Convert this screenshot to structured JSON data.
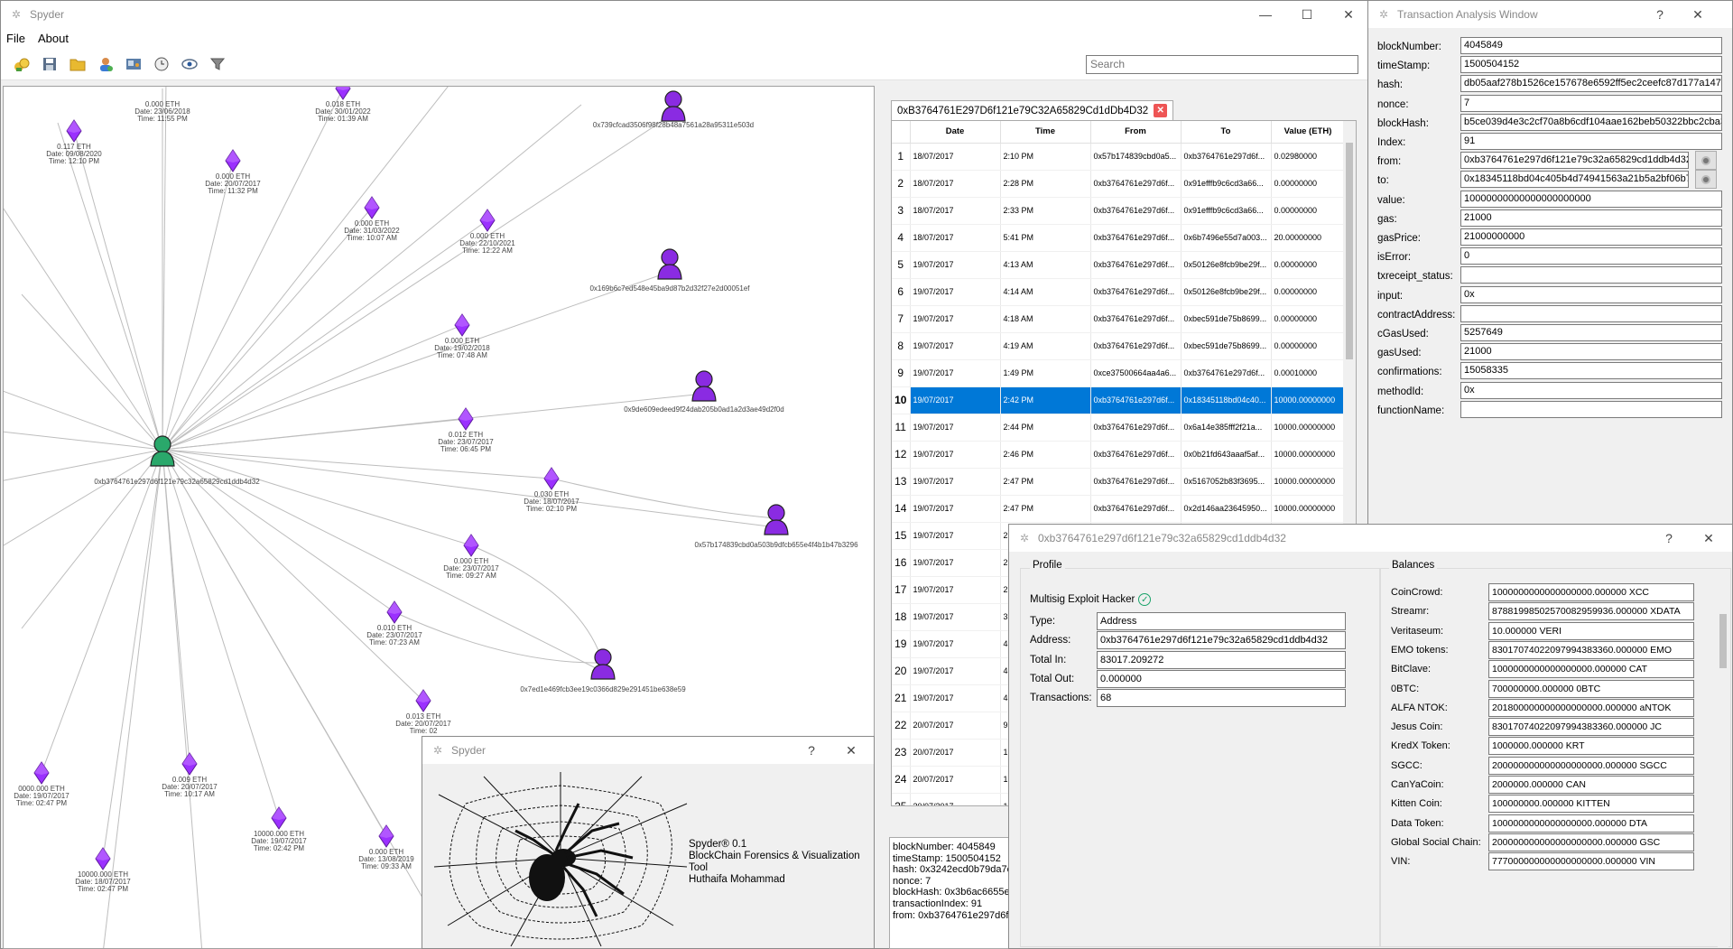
{
  "main_window": {
    "title": "Spyder",
    "menu": [
      "File",
      "About"
    ],
    "search_placeholder": "Search",
    "toolbar_icons": [
      "open-wallet-icon",
      "save-icon",
      "folder-icon",
      "user-icon",
      "card-icon",
      "clock-icon",
      "eye-icon",
      "filter-icon"
    ]
  },
  "graph": {
    "center_node": "0xb3764761e297d6f121e79c32a65829cd1ddb4d32",
    "accounts": [
      "0x739cfcad3506f98f28b48a7561a28a95311e503d",
      "0x169b6c7ed548e45ba9d87b2d32f27e2d00051ef",
      "0x9de609edeed9f24dab205b0ad1a2d3ae49d2f0d",
      "0x57b174839cbd0a503b9dfcb655e4f4b1b47b3296",
      "0x7ed1e469fcb3ee19c0366d829e291451be638e59"
    ],
    "transactions": [
      {
        "amount": "0.117 ETH",
        "date": "Date: 09/08/2020",
        "time": "Time: 12:10 PM"
      },
      {
        "amount": "0.000 ETH",
        "date": "Date: 23/06/2018",
        "time": "Time: 11:55 PM"
      },
      {
        "amount": "0.000 ETH",
        "date": "Date: 20/07/2017",
        "time": "Time: 11:32 PM"
      },
      {
        "amount": "0.018 ETH",
        "date": "Date: 30/01/2022",
        "time": "Time: 01:39 AM"
      },
      {
        "amount": "0.000 ETH",
        "date": "Date: 31/03/2022",
        "time": "Time: 10:07 AM"
      },
      {
        "amount": "0.000 ETH",
        "date": "Date: 22/10/2021",
        "time": "Time: 12:22 AM"
      },
      {
        "amount": "0.000 ETH",
        "date": "Date: 19/02/2018",
        "time": "Time: 07:48 AM"
      },
      {
        "amount": "0.012 ETH",
        "date": "Date: 23/07/2017",
        "time": "Time: 06:45 PM"
      },
      {
        "amount": "0.030 ETH",
        "date": "Date: 18/07/2017",
        "time": "Time: 02:10 PM"
      },
      {
        "amount": "0.000 ETH",
        "date": "Date: 23/07/2017",
        "time": "Time: 09:27 AM"
      },
      {
        "amount": "0.010 ETH",
        "date": "Date: 23/07/2017",
        "time": "Time: 07:23 AM"
      },
      {
        "amount": "0.013 ETH",
        "date": "Date: 20/07/2017",
        "time": "Time: 02"
      },
      {
        "amount": "0000.000 ETH",
        "date": "Date: 19/07/2017",
        "time": "Time: 02:47 PM"
      },
      {
        "amount": "0.009 ETH",
        "date": "Date: 20/07/2017",
        "time": "Time: 10:17 AM"
      },
      {
        "amount": "10000.000 ETH",
        "date": "Date: 19/07/2017",
        "time": "Time: 02:42 PM"
      },
      {
        "amount": "0.000 ETH",
        "date": "Date: 13/08/2019",
        "time": "Time: 09:33 AM"
      },
      {
        "amount": "10000.000 ETH",
        "date": "Date: 18/07/2017",
        "time": "Time: 02:47 PM"
      }
    ]
  },
  "tab": {
    "label": "0xB3764761E297D6f121e79C32A65829Cd1dDb4D32"
  },
  "table": {
    "headers": [
      "Date",
      "Time",
      "From",
      "To",
      "Value (ETH)"
    ],
    "selected_index": 9,
    "rows": [
      {
        "n": "1",
        "date": "18/07/2017",
        "time": "2:10 PM",
        "from": "0x57b174839cbd0a5...",
        "to": "0xb3764761e297d6f...",
        "value": "0.02980000"
      },
      {
        "n": "2",
        "date": "18/07/2017",
        "time": "2:28 PM",
        "from": "0xb3764761e297d6f...",
        "to": "0x91efffb9c6cd3a66...",
        "value": "0.00000000"
      },
      {
        "n": "3",
        "date": "18/07/2017",
        "time": "2:33 PM",
        "from": "0xb3764761e297d6f...",
        "to": "0x91efffb9c6cd3a66...",
        "value": "0.00000000"
      },
      {
        "n": "4",
        "date": "18/07/2017",
        "time": "5:41 PM",
        "from": "0xb3764761e297d6f...",
        "to": "0x6b7496e55d7a003...",
        "value": "20.00000000"
      },
      {
        "n": "5",
        "date": "19/07/2017",
        "time": "4:13 AM",
        "from": "0xb3764761e297d6f...",
        "to": "0x50126e8fcb9be29f...",
        "value": "0.00000000"
      },
      {
        "n": "6",
        "date": "19/07/2017",
        "time": "4:14 AM",
        "from": "0xb3764761e297d6f...",
        "to": "0x50126e8fcb9be29f...",
        "value": "0.00000000"
      },
      {
        "n": "7",
        "date": "19/07/2017",
        "time": "4:18 AM",
        "from": "0xb3764761e297d6f...",
        "to": "0xbec591de75b8699...",
        "value": "0.00000000"
      },
      {
        "n": "8",
        "date": "19/07/2017",
        "time": "4:19 AM",
        "from": "0xb3764761e297d6f...",
        "to": "0xbec591de75b8699...",
        "value": "0.00000000"
      },
      {
        "n": "9",
        "date": "19/07/2017",
        "time": "1:49 PM",
        "from": "0xce37500664aa4a6...",
        "to": "0xb3764761e297d6f...",
        "value": "0.00010000"
      },
      {
        "n": "10",
        "date": "19/07/2017",
        "time": "2:42 PM",
        "from": "0xb3764761e297d6f...",
        "to": "0x18345118bd04c40...",
        "value": "10000.00000000"
      },
      {
        "n": "11",
        "date": "19/07/2017",
        "time": "2:44 PM",
        "from": "0xb3764761e297d6f...",
        "to": "0x6a14e385fff2f21a...",
        "value": "10000.00000000"
      },
      {
        "n": "12",
        "date": "19/07/2017",
        "time": "2:46 PM",
        "from": "0xb3764761e297d6f...",
        "to": "0x0b21fd643aaaf5af...",
        "value": "10000.00000000"
      },
      {
        "n": "13",
        "date": "19/07/2017",
        "time": "2:47 PM",
        "from": "0xb3764761e297d6f...",
        "to": "0x5167052b83f3695...",
        "value": "10000.00000000"
      },
      {
        "n": "14",
        "date": "19/07/2017",
        "time": "2:47 PM",
        "from": "0xb3764761e297d6f...",
        "to": "0x2d146aa23645950...",
        "value": "10000.00000000"
      },
      {
        "n": "15",
        "date": "19/07/2017",
        "time": "2",
        "from": "",
        "to": "",
        "value": ""
      },
      {
        "n": "16",
        "date": "19/07/2017",
        "time": "2",
        "from": "",
        "to": "",
        "value": ""
      },
      {
        "n": "17",
        "date": "19/07/2017",
        "time": "2",
        "from": "",
        "to": "",
        "value": ""
      },
      {
        "n": "18",
        "date": "19/07/2017",
        "time": "3",
        "from": "",
        "to": "",
        "value": ""
      },
      {
        "n": "19",
        "date": "19/07/2017",
        "time": "4",
        "from": "",
        "to": "",
        "value": ""
      },
      {
        "n": "20",
        "date": "19/07/2017",
        "time": "4",
        "from": "",
        "to": "",
        "value": ""
      },
      {
        "n": "21",
        "date": "19/07/2017",
        "time": "4",
        "from": "",
        "to": "",
        "value": ""
      },
      {
        "n": "22",
        "date": "20/07/2017",
        "time": "9",
        "from": "",
        "to": "",
        "value": ""
      },
      {
        "n": "23",
        "date": "20/07/2017",
        "time": "1",
        "from": "",
        "to": "",
        "value": ""
      },
      {
        "n": "24",
        "date": "20/07/2017",
        "time": "1",
        "from": "",
        "to": "",
        "value": ""
      },
      {
        "n": "25",
        "date": "20/07/2017",
        "time": "1",
        "from": "",
        "to": "",
        "value": ""
      }
    ]
  },
  "details_text": {
    "lines": [
      "blockNumber: 4045849",
      "timeStamp: 1500504152",
      "hash: 0x3242ecd0b79da7e",
      "nonce: 7",
      "blockHash: 0x3b6ac6655eb",
      "transactionIndex: 91",
      "from: 0xb3764761e297d6f"
    ]
  },
  "analysis_window": {
    "title": "Transaction Analysis Window",
    "help": "?",
    "close": "✕",
    "fields": [
      {
        "label": "blockNumber:",
        "value": "4045849"
      },
      {
        "label": "timeStamp:",
        "value": "1500504152"
      },
      {
        "label": "hash:",
        "value": "db05aaf278b1526ce157678e6592ff5ec2ceefc87d177a147"
      },
      {
        "label": "nonce:",
        "value": "7"
      },
      {
        "label": "blockHash:",
        "value": "b5ce039d4e3c2cf70a8b6cdf104aae162beb50322bbc2cba3"
      },
      {
        "label": "Index:",
        "value": "91"
      },
      {
        "label": "from:",
        "value": "0xb3764761e297d6f121e79c32a65829cd1ddb4d32"
      },
      {
        "label": "to:",
        "value": "0x18345118bd04c405b4d74941563a21b5a2bf06b7"
      },
      {
        "label": "value:",
        "value": "10000000000000000000000"
      },
      {
        "label": "gas:",
        "value": "21000"
      },
      {
        "label": "gasPrice:",
        "value": "21000000000"
      },
      {
        "label": "isError:",
        "value": "0"
      },
      {
        "label": "txreceipt_status:",
        "value": ""
      },
      {
        "label": "input:",
        "value": "0x"
      },
      {
        "label": "contractAddress:",
        "value": ""
      },
      {
        "label": "cGasUsed:",
        "value": "5257649"
      },
      {
        "label": "gasUsed:",
        "value": "21000"
      },
      {
        "label": "confirmations:",
        "value": "15058335"
      },
      {
        "label": "methodId:",
        "value": "0x"
      },
      {
        "label": "functionName:",
        "value": ""
      }
    ]
  },
  "about_window": {
    "title": "Spyder",
    "help": "?",
    "close": "✕",
    "app": "Spyder® 0.1",
    "subtitle": "BlockChain Forensics & Visualization Tool",
    "author": "Huthaifa Mohammad"
  },
  "profile_window": {
    "title": "0xb3764761e297d6f121e79c32a65829cd1ddb4d32",
    "help": "?",
    "close": "✕",
    "profile_group": "Profile",
    "balances_group": "Balances",
    "tag": "Multisig Exploit Hacker",
    "fields": [
      {
        "label": "Type:",
        "value": "Address"
      },
      {
        "label": "Address:",
        "value": "0xb3764761e297d6f121e79c32a65829cd1ddb4d32"
      },
      {
        "label": "Total In:",
        "value": "83017.209272"
      },
      {
        "label": "Total Out:",
        "value": "0.000000"
      },
      {
        "label": "Transactions:",
        "value": "68"
      }
    ],
    "balances": [
      {
        "label": "CoinCrowd:",
        "value": "1000000000000000000.000000 XCC"
      },
      {
        "label": "Streamr:",
        "value": "87881998502570082959936.000000 XDATA"
      },
      {
        "label": "Veritaseum:",
        "value": "10.000000 VERI"
      },
      {
        "label": "EMO tokens:",
        "value": "83017074022097994383360.000000 EMO"
      },
      {
        "label": "BitClave:",
        "value": "1000000000000000000.000000 CAT"
      },
      {
        "label": "0BTC:",
        "value": "700000000.000000 0BTC"
      },
      {
        "label": "ALFA NTOK:",
        "value": "201800000000000000000.000000 aNTOK"
      },
      {
        "label": "Jesus Coin:",
        "value": "83017074022097994383360.000000 JC"
      },
      {
        "label": "KredX Token:",
        "value": "1000000.000000 KRT"
      },
      {
        "label": "SGCC:",
        "value": "200000000000000000000.000000 SGCC"
      },
      {
        "label": "CanYaCoin:",
        "value": "2000000.000000 CAN"
      },
      {
        "label": "Kitten Coin:",
        "value": "100000000.000000 KITTEN"
      },
      {
        "label": "Data Token:",
        "value": "1000000000000000000.000000 DTA"
      },
      {
        "label": "Global Social Chain:",
        "value": "200000000000000000000.000000 GSC"
      },
      {
        "label": "VIN:",
        "value": "777000000000000000000.000000 VIN"
      }
    ]
  },
  "colors": {
    "selection": "#0078d7",
    "node_center": "#2aa86b",
    "node_account": "#8a2be2",
    "diamond": "#9b30ff"
  }
}
